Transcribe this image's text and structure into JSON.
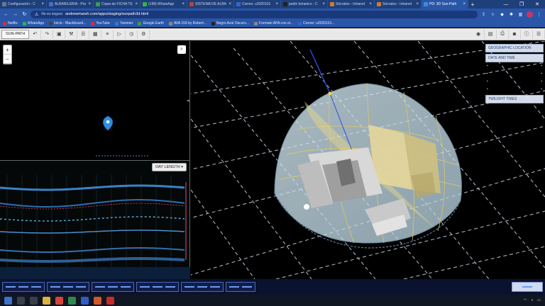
{
  "browser": {
    "tabs": [
      {
        "label": "Configuración - C",
        "color": "#6a7a8e"
      },
      {
        "label": "ALBAÑILERIA - Pre",
        "color": "#3d73c9"
      },
      {
        "label": "Copia de FICHA TE",
        "color": "#3d9b4f"
      },
      {
        "label": "(198) WhatsApp",
        "color": "#2fb350"
      },
      {
        "label": "SISTEMA DE ALBA",
        "color": "#b3443a"
      },
      {
        "label": "Correo: u2020101",
        "color": "#2f68c8"
      },
      {
        "label": "jardin botanico - C",
        "color": "#222222"
      },
      {
        "label": "Sócrates - Intranet",
        "color": "#d27a2a"
      },
      {
        "label": "Sócrates - Intranet",
        "color": "#d27a2a"
      },
      {
        "label": "PD: 3D Sun-Path",
        "color": "#3a8fd8"
      }
    ],
    "url_secure": "No es seguro",
    "url": "andrewmarsh.com/apps/staging/sunpath3d.html",
    "bookmarks": [
      {
        "label": "Netflix",
        "color": "#e12b2b"
      },
      {
        "label": "WhatsApp",
        "color": "#2fb350"
      },
      {
        "label": "Inicio - Blackboard...",
        "color": "#444444"
      },
      {
        "label": "YouTube",
        "color": "#e12b2b"
      },
      {
        "label": "Yammer",
        "color": "#3d73c9"
      },
      {
        "label": "Google Earth",
        "color": "#3d9b4f"
      },
      {
        "label": "AVA 159 by Robert...",
        "color": "#888888"
      },
      {
        "label": "Negro Azul Oscuro...",
        "color": "#222222"
      },
      {
        "label": "Formato APA con el...",
        "color": "#888888"
      },
      {
        "label": "Correo: u2020101...",
        "color": "#2f68c8"
      }
    ]
  },
  "app": {
    "title": "SUN-PATH",
    "toolbar_left": [
      "undo-icon",
      "redo-icon",
      "cube-icon",
      "tools-icon",
      "layers-icon",
      "grid-icon",
      "list-icon",
      "play-icon",
      "clock-icon",
      "settings-icon"
    ],
    "toolbar_right": [
      "eye-icon",
      "view-icon",
      "print-icon",
      "camera-icon",
      "info-icon",
      "menu-icon"
    ]
  },
  "map": {
    "zoom_in": "+",
    "zoom_out": "−"
  },
  "chart": {
    "selector": "DAY LENGTH"
  },
  "side_panel": {
    "section1": "GEOGRAPHIC LOCATION",
    "section2": "DATE AND TIME",
    "section3": "TWILIGHT TIMES"
  },
  "colors": {
    "accent": "#2a56a8",
    "dome": "#cfe6ef",
    "sunpath": "#d9c66a",
    "grid": "#cfd7e6"
  }
}
